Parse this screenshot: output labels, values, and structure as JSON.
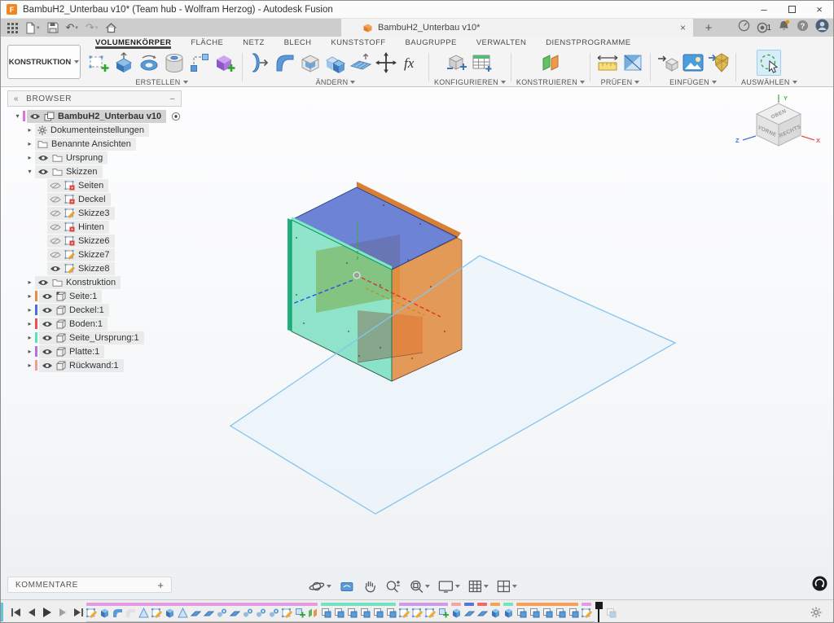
{
  "window": {
    "title": "BambuH2_Unterbau v10* (Team hub - Wolfram Herzog) - Autodesk Fusion",
    "logo_letter": "F"
  },
  "icons": {
    "caret": "▾",
    "expander_open": "▾",
    "expander_closed": "▸",
    "close": "×",
    "add": "+",
    "minimize": "–",
    "collapse": "«",
    "panel_collapse": "–",
    "help": "?",
    "undo": "↶",
    "redo": "↷"
  },
  "tabstrip": {
    "document_tab": {
      "label": "BambuH2_Unterbau v10*"
    },
    "job_count": "1"
  },
  "toolbar": {
    "konstruktion_label": "KONSTRUKTION",
    "fx_label": "fx",
    "tabs": [
      {
        "label": "VOLUMENKÖRPER",
        "active": true
      },
      {
        "label": "FLÄCHE",
        "active": false
      },
      {
        "label": "NETZ",
        "active": false
      },
      {
        "label": "BLECH",
        "active": false
      },
      {
        "label": "KUNSTSTOFF",
        "active": false
      },
      {
        "label": "BAUGRUPPE",
        "active": false
      },
      {
        "label": "VERWALTEN",
        "active": false
      },
      {
        "label": "DIENSTPROGRAMME",
        "active": false
      }
    ],
    "groups": [
      {
        "label": "ERSTELLEN"
      },
      {
        "label": "ÄNDERN"
      },
      {
        "label": "KONFIGURIEREN"
      },
      {
        "label": "KONSTRUIEREN"
      },
      {
        "label": "PRÜFEN"
      },
      {
        "label": "EINFÜGEN"
      },
      {
        "label": "AUSWÄHLEN"
      }
    ]
  },
  "browser": {
    "header": "BROWSER",
    "items": [
      {
        "label": "BambuH2_Unterbau v10",
        "indent": 0,
        "expander": "open",
        "eye": "on",
        "icon": "component",
        "swatch": "#e570d8",
        "selected": true,
        "radio": true
      },
      {
        "label": "Dokumenteinstellungen",
        "indent": 1,
        "expander": "closed",
        "eye": null,
        "icon": "gear",
        "swatch": null
      },
      {
        "label": "Benannte Ansichten",
        "indent": 1,
        "expander": "closed",
        "eye": null,
        "icon": "folder",
        "swatch": null
      },
      {
        "label": "Ursprung",
        "indent": 1,
        "expander": "closed",
        "eye": "on",
        "icon": "folder",
        "swatch": null
      },
      {
        "label": "Skizzen",
        "indent": 1,
        "expander": "open",
        "eye": "on",
        "icon": "folder",
        "swatch": null
      },
      {
        "label": "Seiten",
        "indent": 2,
        "expander": null,
        "eye": "off",
        "icon": "sketch-lock",
        "swatch": null
      },
      {
        "label": "Deckel",
        "indent": 2,
        "expander": null,
        "eye": "off",
        "icon": "sketch-lock",
        "swatch": null
      },
      {
        "label": "Skizze3",
        "indent": 2,
        "expander": null,
        "eye": "off",
        "icon": "sketch",
        "swatch": null
      },
      {
        "label": "Hinten",
        "indent": 2,
        "expander": null,
        "eye": "off",
        "icon": "sketch-lock",
        "swatch": null
      },
      {
        "label": "Skizze6",
        "indent": 2,
        "expander": null,
        "eye": "off",
        "icon": "sketch-lock",
        "swatch": null
      },
      {
        "label": "Skizze7",
        "indent": 2,
        "expander": null,
        "eye": "off",
        "icon": "sketch",
        "swatch": null
      },
      {
        "label": "Skizze8",
        "indent": 2,
        "expander": null,
        "eye": "on",
        "icon": "sketch",
        "swatch": null
      },
      {
        "label": "Konstruktion",
        "indent": 1,
        "expander": "closed",
        "eye": "on",
        "icon": "folder",
        "swatch": null
      },
      {
        "label": "Seite:1",
        "indent": 1,
        "expander": "closed",
        "eye": "on",
        "icon": "body-link",
        "swatch": "#f08c3a"
      },
      {
        "label": "Deckel:1",
        "indent": 1,
        "expander": "closed",
        "eye": "on",
        "icon": "body",
        "swatch": "#4a6fd6"
      },
      {
        "label": "Boden:1",
        "indent": 1,
        "expander": "closed",
        "eye": "on",
        "icon": "body",
        "swatch": "#ed4e58"
      },
      {
        "label": "Seite_Ursprung:1",
        "indent": 1,
        "expander": "closed",
        "eye": "on",
        "icon": "body",
        "swatch": "#55e6b4"
      },
      {
        "label": "Platte:1",
        "indent": 1,
        "expander": "closed",
        "eye": "on",
        "icon": "body",
        "swatch": "#ae74e6"
      },
      {
        "label": "Rückwand:1",
        "indent": 1,
        "expander": "closed",
        "eye": "on",
        "icon": "body",
        "swatch": "#f59a94"
      }
    ]
  },
  "viewcube": {
    "faces": {
      "top": "OBEN",
      "front": "VORNE",
      "right": "RECHTS"
    },
    "axes": {
      "x": "X",
      "y": "Y",
      "z": "Z"
    },
    "axis_colors": {
      "x": "#e05252",
      "y": "#4caf50",
      "z": "#4a6fd6"
    }
  },
  "model": {
    "colors": {
      "top": "#4a66cc",
      "left": "#38d19e",
      "right": "#e0883a",
      "right_rim": "#d87f33",
      "bottom": "#e04848",
      "back": "#d9a33c",
      "plane_fill": "#e9f3fb",
      "plane_stroke": "#85c5ec"
    }
  },
  "comments": {
    "label": "KOMMENTARE"
  },
  "timeline": {
    "palette": {
      "m": "#e29ae2",
      "t": "#72e4c4",
      "v": "#cf9ae8",
      "p": "#f4a4a4",
      "b": "#5577d9",
      "r": "#ed6a66",
      "o": "#f4a057"
    },
    "items": [
      {
        "t": "sketch",
        "g": "m"
      },
      {
        "t": "extrude",
        "g": "m"
      },
      {
        "t": "fillet",
        "g": "m"
      },
      {
        "t": "ghostshape",
        "g": "m"
      },
      {
        "t": "tri",
        "g": "m"
      },
      {
        "t": "sketch",
        "g": "m"
      },
      {
        "t": "extrude",
        "g": "m"
      },
      {
        "t": "tri",
        "g": "m"
      },
      {
        "t": "slab",
        "g": "m"
      },
      {
        "t": "slab",
        "g": "m"
      },
      {
        "t": "joint",
        "g": "m"
      },
      {
        "t": "slab",
        "g": "m"
      },
      {
        "t": "joint",
        "g": "m"
      },
      {
        "t": "joint",
        "g": "m"
      },
      {
        "t": "joint",
        "g": "m"
      },
      {
        "t": "sketch",
        "g": "m"
      },
      {
        "t": "newcomp",
        "g": "m"
      },
      {
        "t": "plane",
        "g": "m"
      },
      {
        "t": "pattern",
        "g": "t"
      },
      {
        "t": "pattern",
        "g": "t"
      },
      {
        "t": "pattern",
        "g": "t"
      },
      {
        "t": "pattern",
        "g": "t"
      },
      {
        "t": "pattern",
        "g": "t"
      },
      {
        "t": "pattern",
        "g": "t"
      },
      {
        "t": "sketch",
        "g": "v"
      },
      {
        "t": "sketch",
        "g": "v"
      },
      {
        "t": "sketch",
        "g": "v"
      },
      {
        "t": "newcomp",
        "g": "v"
      },
      {
        "t": "extrude",
        "g": "p"
      },
      {
        "t": "slab",
        "g": "b"
      },
      {
        "t": "slab",
        "g": "r"
      },
      {
        "t": "extrude",
        "g": "o"
      },
      {
        "t": "extrude",
        "g": "t"
      },
      {
        "t": "pattern",
        "g": "o"
      },
      {
        "t": "pattern",
        "g": "o"
      },
      {
        "t": "pattern",
        "g": "o"
      },
      {
        "t": "pattern",
        "g": "o"
      },
      {
        "t": "pattern",
        "g": "o"
      },
      {
        "t": "sketch",
        "g": "m"
      }
    ]
  }
}
